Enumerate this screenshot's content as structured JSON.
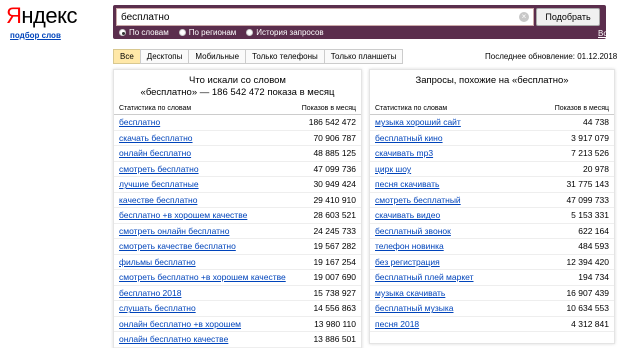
{
  "logo": {
    "first_letter": "Я",
    "rest": "ндекс"
  },
  "subtitle": "подбор слов",
  "search": {
    "value": "бесплатно",
    "button": "Подобрать",
    "clear_glyph": "×"
  },
  "radios": [
    {
      "label": "По словам",
      "selected": true
    },
    {
      "label": "По регионам",
      "selected": false
    },
    {
      "label": "История запросов",
      "selected": false
    }
  ],
  "all_regions": "Все регионы",
  "tabs": [
    {
      "label": "Все",
      "active": true
    },
    {
      "label": "Десктопы",
      "active": false
    },
    {
      "label": "Мобильные",
      "active": false
    },
    {
      "label": "Только телефоны",
      "active": false
    },
    {
      "label": "Только планшеты",
      "active": false
    }
  ],
  "last_update": "Последнее обновление: 01.12.2018",
  "left_panel": {
    "title_line1": "Что искали со словом",
    "title_line2": "«бесплатно» — 186 542 472 показа в месяц",
    "col_query": "Статистика по словам",
    "col_count": "Показов в месяц",
    "rows": [
      {
        "q": "бесплатно",
        "n": "186 542 472"
      },
      {
        "q": "скачать бесплатно",
        "n": "70 906 787"
      },
      {
        "q": "онлайн бесплатно",
        "n": "48 885 125"
      },
      {
        "q": "смотреть бесплатно",
        "n": "47 099 736"
      },
      {
        "q": "лучшие бесплатные",
        "n": "30 949 424"
      },
      {
        "q": "качестве бесплатно",
        "n": "29 410 910"
      },
      {
        "q": "бесплатно +в хорошем качестве",
        "n": "28 603 521"
      },
      {
        "q": "смотреть онлайн бесплатно",
        "n": "24 245 733"
      },
      {
        "q": "смотреть качестве бесплатно",
        "n": "19 567 282"
      },
      {
        "q": "фильмы бесплатно",
        "n": "19 167 254"
      },
      {
        "q": "смотреть бесплатно +в хорошем качестве",
        "n": "19 007 690"
      },
      {
        "q": "бесплатно 2018",
        "n": "15 738 927"
      },
      {
        "q": "слушать бесплатно",
        "n": "14 556 863"
      },
      {
        "q": "онлайн бесплатно +в хорошем",
        "n": "13 980 110"
      },
      {
        "q": "онлайн бесплатно качестве",
        "n": "13 886 501"
      }
    ]
  },
  "right_panel": {
    "title": "Запросы, похожие на «бесплатно»",
    "col_query": "Статистика по словам",
    "col_count": "Показов в месяц",
    "rows": [
      {
        "q": "музыка хороший сайт",
        "n": "44 738"
      },
      {
        "q": "бесплатный кино",
        "n": "3 917 079"
      },
      {
        "q": "скачивать mp3",
        "n": "7 213 526"
      },
      {
        "q": "цирк шоу",
        "n": "20 978"
      },
      {
        "q": "песня скачивать",
        "n": "31 775 143"
      },
      {
        "q": "смотреть бесплатный",
        "n": "47 099 733"
      },
      {
        "q": "скачивать видео",
        "n": "5 153 331"
      },
      {
        "q": "бесплатный звонок",
        "n": "622 164"
      },
      {
        "q": "телефон новинка",
        "n": "484 593"
      },
      {
        "q": "без регистрация",
        "n": "12 394 420"
      },
      {
        "q": "бесплатный плей маркет",
        "n": "194 734"
      },
      {
        "q": "музыка скачивать",
        "n": "16 907 439"
      },
      {
        "q": "бесплатный музыка",
        "n": "10 634 553"
      },
      {
        "q": "песня 2018",
        "n": "4 312 841"
      }
    ]
  }
}
